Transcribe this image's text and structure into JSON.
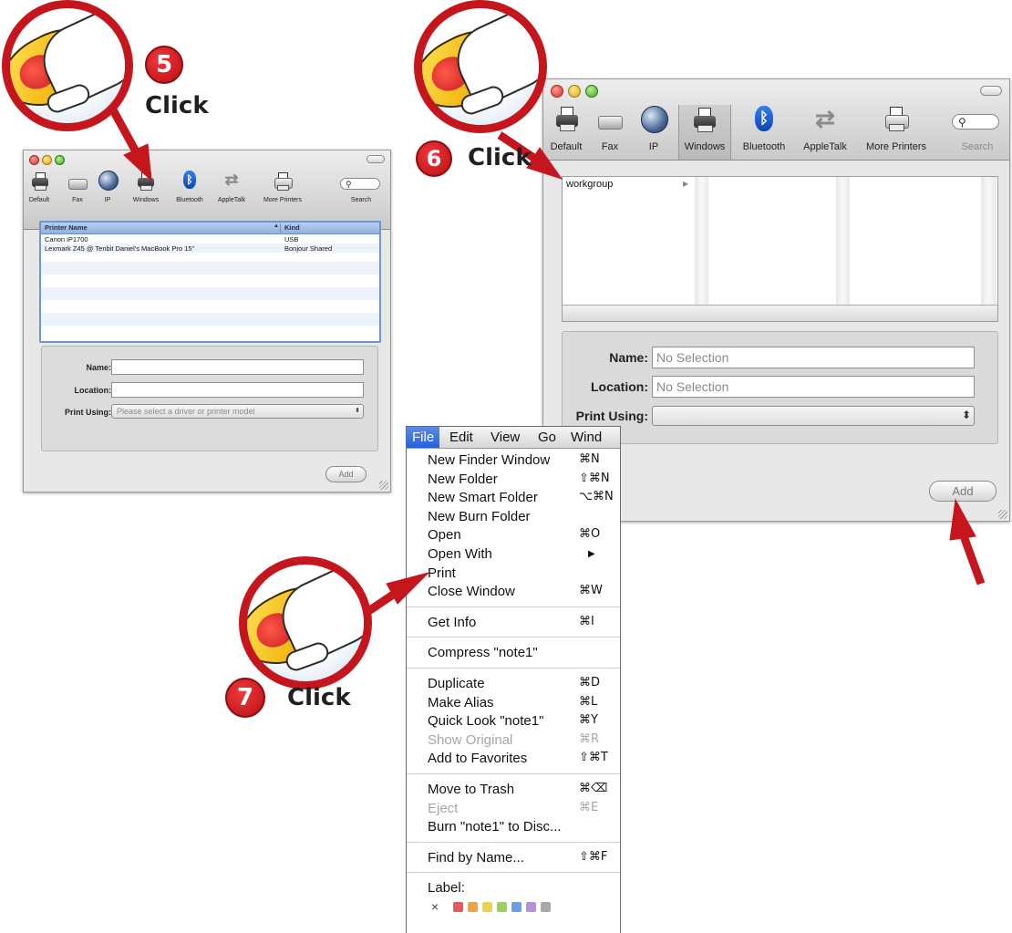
{
  "colors": {
    "callout_red": "#c4161c",
    "menu_highlight": "#2760d8",
    "list_highlight": "#8fb0e0"
  },
  "callouts": [
    {
      "number": "5",
      "label": "Click"
    },
    {
      "number": "6",
      "label": "Click"
    },
    {
      "number": "7",
      "label": "Click"
    }
  ],
  "window_left": {
    "toolbar": [
      {
        "label": "Default",
        "icon": "printer-icon"
      },
      {
        "label": "Fax",
        "icon": "fax-icon"
      },
      {
        "label": "IP",
        "icon": "globe-icon"
      },
      {
        "label": "Windows",
        "icon": "printer-icon"
      },
      {
        "label": "Bluetooth",
        "icon": "bluetooth-icon"
      },
      {
        "label": "AppleTalk",
        "icon": "arrows-icon"
      },
      {
        "label": "More Printers",
        "icon": "printer-icon"
      },
      {
        "label": "Search",
        "icon": "search-icon"
      }
    ],
    "columns": {
      "name": "Printer Name",
      "kind": "Kind"
    },
    "rows": [
      {
        "name": "Canon iP1700",
        "kind": "USB"
      },
      {
        "name": "Lexmark Z45 @ Tenbit Daniel's MacBook Pro 15\"",
        "kind": "Bonjour Shared"
      }
    ],
    "form": {
      "name_label": "Name:",
      "location_label": "Location:",
      "print_using_label": "Print Using:",
      "print_using_value": "Please select a driver or printer model"
    },
    "add_label": "Add"
  },
  "window_right": {
    "toolbar": [
      {
        "label": "Default",
        "icon": "printer-icon"
      },
      {
        "label": "Fax",
        "icon": "fax-icon"
      },
      {
        "label": "IP",
        "icon": "globe-icon"
      },
      {
        "label": "Windows",
        "icon": "printer-icon",
        "selected": true
      },
      {
        "label": "Bluetooth",
        "icon": "bluetooth-icon"
      },
      {
        "label": "AppleTalk",
        "icon": "arrows-icon"
      },
      {
        "label": "More Printers",
        "icon": "printer-icon"
      },
      {
        "label": "Search",
        "icon": "search-icon"
      }
    ],
    "browser_item": "workgroup",
    "form": {
      "name_label": "Name:",
      "name_value": "No Selection",
      "location_label": "Location:",
      "location_value": "No Selection",
      "print_using_label": "Print Using:"
    },
    "add_label": "Add"
  },
  "menu": {
    "menubar": [
      "File",
      "Edit",
      "View",
      "Go",
      "Wind"
    ],
    "groups": [
      [
        {
          "label": "New Finder Window",
          "shortcut": "⌘N"
        },
        {
          "label": "New Folder",
          "shortcut": "⇧⌘N"
        },
        {
          "label": "New Smart Folder",
          "shortcut": "⌥⌘N"
        },
        {
          "label": "New Burn Folder",
          "shortcut": ""
        },
        {
          "label": "Open",
          "shortcut": "⌘O"
        },
        {
          "label": "Open With",
          "shortcut": "▶"
        },
        {
          "label": "Print",
          "shortcut": ""
        },
        {
          "label": "Close Window",
          "shortcut": "⌘W"
        }
      ],
      [
        {
          "label": "Get Info",
          "shortcut": "⌘I"
        }
      ],
      [
        {
          "label": "Compress \"note1\"",
          "shortcut": ""
        }
      ],
      [
        {
          "label": "Duplicate",
          "shortcut": "⌘D"
        },
        {
          "label": "Make Alias",
          "shortcut": "⌘L"
        },
        {
          "label": "Quick Look \"note1\"",
          "shortcut": "⌘Y"
        },
        {
          "label": "Show Original",
          "shortcut": "⌘R",
          "disabled": true
        },
        {
          "label": "Add to Favorites",
          "shortcut": "⇧⌘T"
        }
      ],
      [
        {
          "label": "Move to Trash",
          "shortcut": "⌘⌫"
        },
        {
          "label": "Eject",
          "shortcut": "⌘E",
          "disabled": true
        },
        {
          "label": "Burn \"note1\" to Disc...",
          "shortcut": ""
        }
      ],
      [
        {
          "label": "Find by Name...",
          "shortcut": "⇧⌘F"
        }
      ],
      [
        {
          "label": "Label:",
          "shortcut": ""
        }
      ]
    ],
    "label_clear": "×",
    "label_colors": [
      "#e8575a",
      "#f2a23c",
      "#f0d24a",
      "#9bd25a",
      "#6aa0ea",
      "#b690dc",
      "#a8a8a8"
    ]
  }
}
